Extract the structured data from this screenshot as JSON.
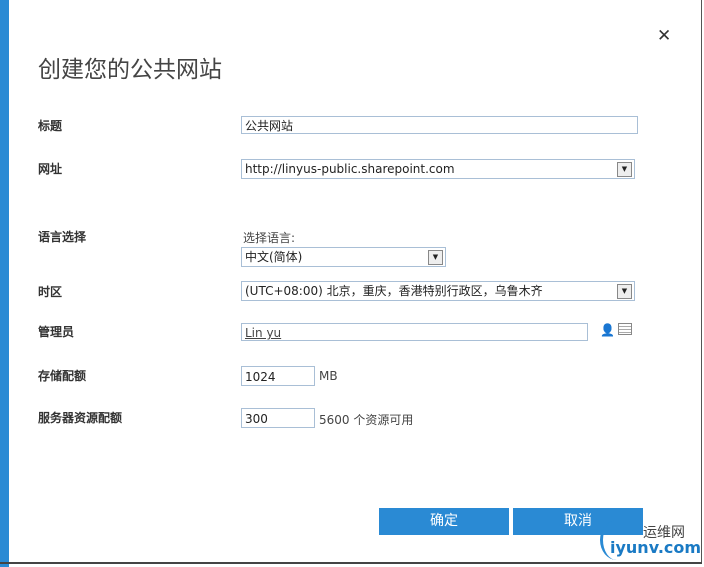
{
  "dialog": {
    "title": "创建您的公共网站",
    "close": "✕"
  },
  "fields": {
    "title_label": "标题",
    "title_value": "公共网站",
    "url_label": "网址",
    "url_value": "http://linyus-public.sharepoint.com",
    "language_label": "语言选择",
    "language_hint": "选择语言:",
    "language_value": "中文(简体)",
    "timezone_label": "时区",
    "timezone_value": "(UTC+08:00) 北京，重庆，香港特别行政区，乌鲁木齐",
    "admin_label": "管理员",
    "admin_value": "Lin yu",
    "storage_label": "存储配额",
    "storage_value": "1024",
    "storage_unit": "MB",
    "resource_label": "服务器资源配额",
    "resource_value": "300",
    "resource_note": "5600 个资源可用"
  },
  "buttons": {
    "ok": "确定",
    "cancel": "取消"
  },
  "watermark": {
    "line1": "运维网",
    "line2": "iyunv.com"
  }
}
